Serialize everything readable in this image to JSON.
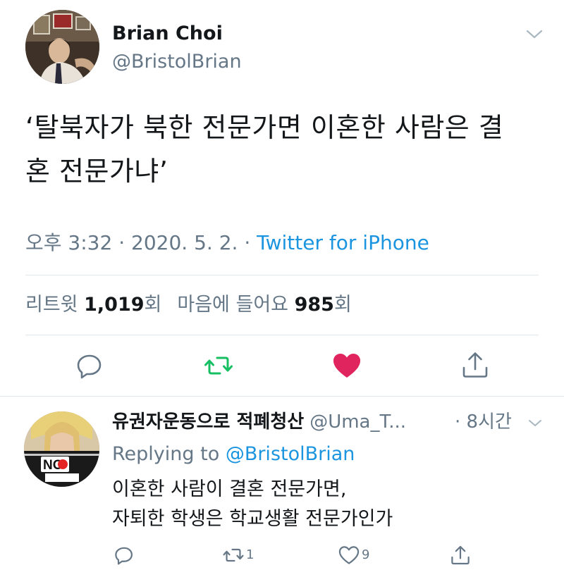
{
  "main_tweet": {
    "author_name": "Brian Choi",
    "author_handle": "@BristolBrian",
    "text_line1": "‘탈북자가 북한 전문가면 이혼한 사람은 결",
    "text_line2": "혼 전문가냐’",
    "time": "오후 3:32",
    "date": "2020. 5. 2.",
    "separator": "·",
    "source": "Twitter for iPhone",
    "retweets_label": "리트윗",
    "retweets_count": "1,019",
    "retweets_unit": "회",
    "likes_label": "마음에 들어요",
    "likes_count": "985",
    "likes_unit": "회",
    "liked": true,
    "icons": {
      "menu": "chevron-down-icon",
      "reply": "reply-bubble-icon",
      "retweet": "retweet-icon",
      "like": "heart-icon",
      "share": "share-icon"
    }
  },
  "reply_tweet": {
    "author_name": "유권자운동으로 적폐청산",
    "author_handle": "@Uma_T...",
    "time": "· 8시간",
    "replying_prefix": "Replying to",
    "replying_to": "@BristolBrian",
    "text_line1": "이혼한 사람이 결혼 전문가면,",
    "text_line2": "자퇴한 학생은 학교생활 전문가인가",
    "avatar_badge": "NO",
    "retweet_count": "1",
    "like_count": "9"
  },
  "colors": {
    "text": "#14171a",
    "secondary": "#657786",
    "link": "#1b95e0",
    "retweet_green": "#17bf63",
    "like_red": "#e0245e",
    "divider": "#e1e8ed"
  }
}
